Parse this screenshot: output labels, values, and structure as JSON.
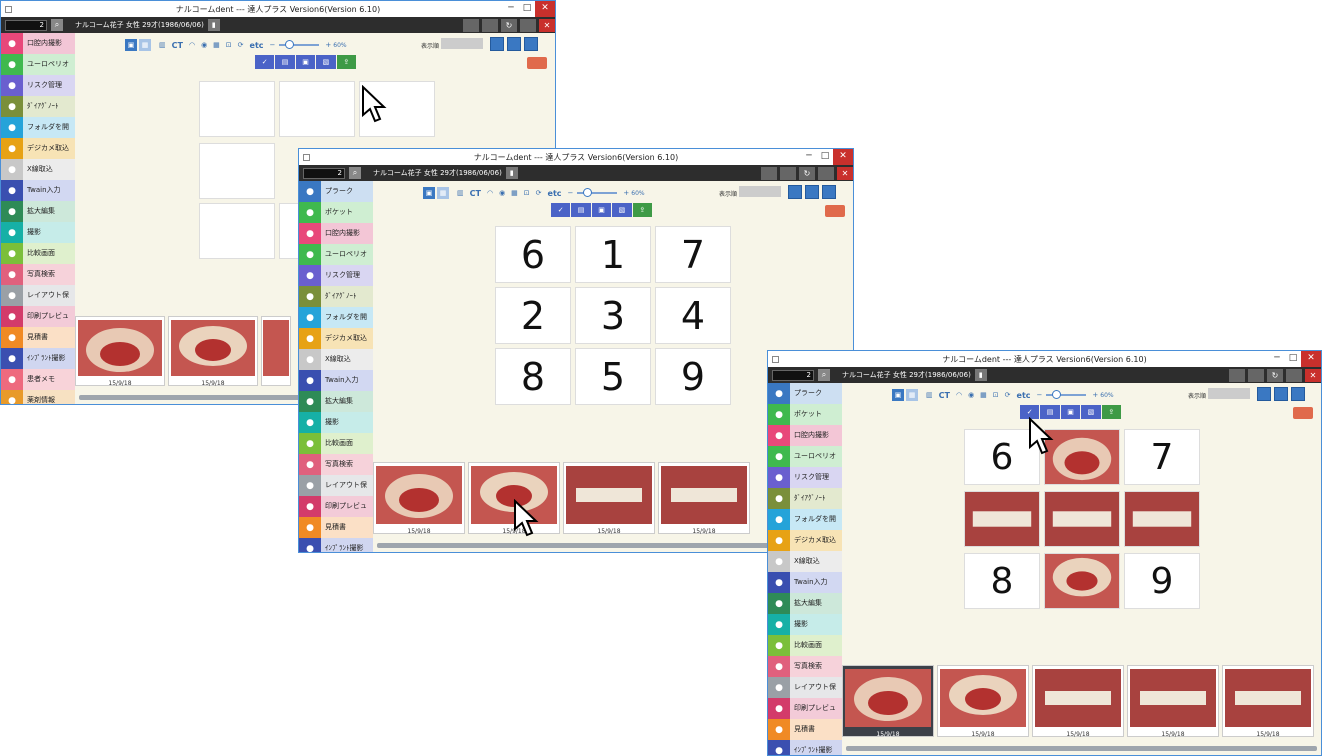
{
  "window": {
    "title_vendor": "ナルコームdent",
    "title_sep": "---",
    "title_app": "達人プラス Version6(Version 6.10)",
    "min": "─",
    "max": "□",
    "close": "✕"
  },
  "header": {
    "patient_id": "2",
    "patient_name": "ナルコーム花子 女性 29才(1986/06/06)"
  },
  "sidebar_w1": [
    {
      "label": "口腔内撮影",
      "color": "#e8487a",
      "icon": "mouth-icon",
      "bg": "#f3c6d6"
    },
    {
      "label": "ユーロペリオ",
      "color": "#3fb94e",
      "icon": "tooth-icon",
      "bg": "#cfeed2"
    },
    {
      "label": "リスク管理",
      "color": "#6a5fcf",
      "icon": "gear-icon",
      "bg": "#d9d6f2"
    },
    {
      "label": "ﾀﾞｲｱｸﾞﾉｰﾄ",
      "color": "#7a8f3a",
      "icon": "apple-icon",
      "bg": "#e3e9cf"
    },
    {
      "label": "フォルダを開く",
      "color": "#25a3d9",
      "icon": "folder-icon",
      "bg": "#c7e8f5"
    },
    {
      "label": "デジカメ取込",
      "color": "#e7a215",
      "icon": "camera-icon",
      "bg": "#f7e3b5"
    },
    {
      "label": "X線取込",
      "color": "#c8c8c8",
      "icon": "xray-icon",
      "bg": "#ececec"
    },
    {
      "label": "Twain入力",
      "color": "#3a4fb0",
      "icon": "scanner-icon",
      "bg": "#d2d8f2"
    },
    {
      "label": "拡大編集",
      "color": "#2e8b57",
      "icon": "zoom-icon",
      "bg": "#cde8da"
    },
    {
      "label": "撮影",
      "color": "#16b0a6",
      "icon": "film-icon",
      "bg": "#c6ece9"
    },
    {
      "label": "比較画面",
      "color": "#7bbf3a",
      "icon": "compare-icon",
      "bg": "#dff0cd"
    },
    {
      "label": "写真検索",
      "color": "#e0607d",
      "icon": "search-photo-icon",
      "bg": "#f6d2da"
    },
    {
      "label": "レイアウト保存",
      "color": "#9aa0a6",
      "icon": "grid-icon",
      "bg": "#e6e7e9"
    },
    {
      "label": "印刷プレビュー",
      "color": "#d33b6a",
      "icon": "printer-icon",
      "bg": "#f3cbd8"
    },
    {
      "label": "見積書",
      "color": "#f08a24",
      "icon": "document-icon",
      "bg": "#fbe0c6"
    },
    {
      "label": "ｲﾝﾌﾟﾗﾝﾄ撮影",
      "color": "#3b4fb0",
      "icon": "implant-icon",
      "bg": "#d0d6f0"
    },
    {
      "label": "患者メモ",
      "color": "#ee6a7e",
      "icon": "memo-icon",
      "bg": "#f8d3d9"
    },
    {
      "label": "薬剤情報",
      "color": "#e89a2a",
      "icon": "drug-icon",
      "bg": "#f7e1c2"
    }
  ],
  "sidebar": [
    {
      "label": "プラーク",
      "color": "#3a78c2",
      "icon": "plaque-icon",
      "bg": "#cddff2"
    },
    {
      "label": "ポケット",
      "color": "#3fb94e",
      "icon": "pocket-icon",
      "bg": "#cfeed2"
    },
    {
      "label": "口腔内撮影",
      "color": "#e8487a",
      "icon": "mouth-icon",
      "bg": "#f3c6d6"
    },
    {
      "label": "ユーロペリオ",
      "color": "#3fb94e",
      "icon": "tooth-icon",
      "bg": "#cfeed2"
    },
    {
      "label": "リスク管理",
      "color": "#6a5fcf",
      "icon": "gear-icon",
      "bg": "#d9d6f2"
    },
    {
      "label": "ﾀﾞｲｱｸﾞﾉｰﾄ",
      "color": "#7a8f3a",
      "icon": "apple-icon",
      "bg": "#e3e9cf"
    },
    {
      "label": "フォルダを開く",
      "color": "#25a3d9",
      "icon": "folder-icon",
      "bg": "#c7e8f5"
    },
    {
      "label": "デジカメ取込",
      "color": "#e7a215",
      "icon": "camera-icon",
      "bg": "#f7e3b5"
    },
    {
      "label": "X線取込",
      "color": "#c8c8c8",
      "icon": "xray-icon",
      "bg": "#ececec"
    },
    {
      "label": "Twain入力",
      "color": "#3a4fb0",
      "icon": "scanner-icon",
      "bg": "#d2d8f2"
    },
    {
      "label": "拡大編集",
      "color": "#2e8b57",
      "icon": "zoom-icon",
      "bg": "#cde8da"
    },
    {
      "label": "撮影",
      "color": "#16b0a6",
      "icon": "film-icon",
      "bg": "#c6ece9"
    },
    {
      "label": "比較画面",
      "color": "#7bbf3a",
      "icon": "compare-icon",
      "bg": "#dff0cd"
    },
    {
      "label": "写真検索",
      "color": "#e0607d",
      "icon": "search-photo-icon",
      "bg": "#f6d2da"
    },
    {
      "label": "レイアウト保存",
      "color": "#9aa0a6",
      "icon": "grid-icon",
      "bg": "#e6e7e9"
    },
    {
      "label": "印刷プレビュー",
      "color": "#d33b6a",
      "icon": "printer-icon",
      "bg": "#f3cbd8"
    },
    {
      "label": "見積書",
      "color": "#f08a24",
      "icon": "document-icon",
      "bg": "#fbe0c6"
    },
    {
      "label": "ｲﾝﾌﾟﾗﾝﾄ撮影",
      "color": "#3b4fb0",
      "icon": "implant-icon",
      "bg": "#d0d6f0"
    }
  ],
  "toolbar": {
    "ct": "CT",
    "etc": "etc",
    "minus": "−",
    "plus": "+",
    "zoom": "60%",
    "sort_label": "表示順"
  },
  "grid2_numbers": [
    "6",
    "1",
    "7",
    "2",
    "3",
    "4",
    "8",
    "5",
    "9"
  ],
  "grid3_numbers": {
    "top_left": "6",
    "top_right": "7",
    "bottom_left": "8",
    "bottom_right": "9"
  },
  "thumb_date": "15/9/18",
  "colors": {
    "accent": "#3a78c2",
    "pagenav": "#4b63c7",
    "green": "#3e9a46",
    "bg": "#f7f5e8"
  }
}
